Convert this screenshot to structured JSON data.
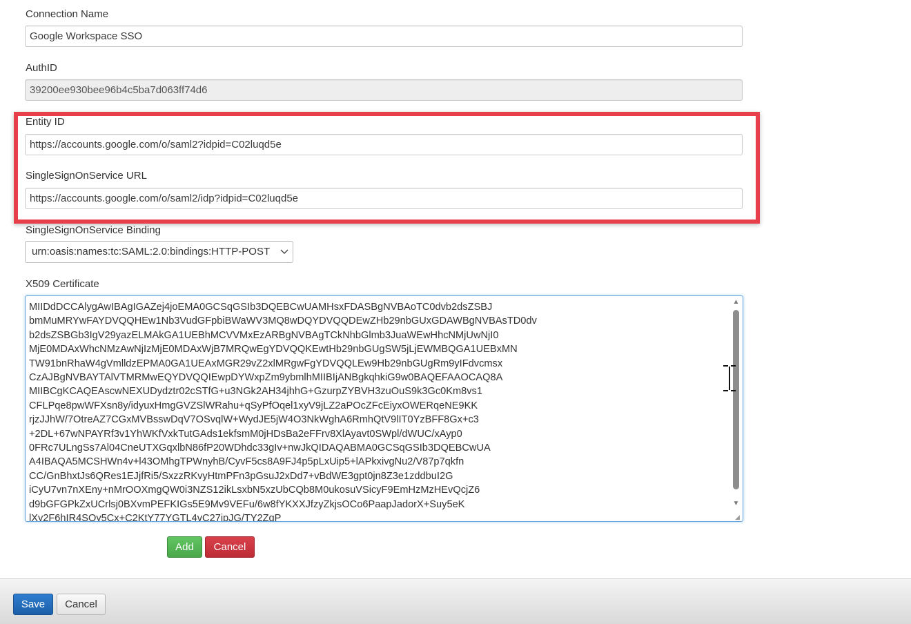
{
  "connection_name": {
    "label": "Connection Name",
    "value": "Google Workspace SSO"
  },
  "auth_id": {
    "label": "AuthID",
    "value": "39200ee930bee96b4c5ba7d063ff74d6"
  },
  "entity_id": {
    "label": "Entity ID",
    "value": "https://accounts.google.com/o/saml2?idpid=C02luqd5e"
  },
  "sso_url": {
    "label": "SingleSignOnService URL",
    "value": "https://accounts.google.com/o/saml2/idp?idpid=C02luqd5e"
  },
  "sso_binding": {
    "label": "SingleSignOnService Binding",
    "value": "urn:oasis:names:tc:SAML:2.0:bindings:HTTP-POST"
  },
  "certificate": {
    "label": "X509 Certificate",
    "lines": [
      "MIIDdDCCAlygAwIBAgIGAZej4joEMA0GCSqGSIb3DQEBCwUAMHsxFDASBgNVBAoTC0dvb2dsZSBJ",
      "bmMuMRYwFAYDVQQHEw1Nb3VudGFpbiBWaWV3MQ8wDQYDVQQDEwZHb29nbGUxGDAWBgNVBAsTD0dv",
      "b2dsZSBGb3IgV29yazELMAkGA1UEBhMCVVMxEzARBgNVBAgTCkNhbGlmb3JuaWEwHhcNMjUwNjI0",
      "MjE0MDAxWhcNMzAwNjIzMjE0MDAxWjB7MRQwEgYDVQQKEwtHb29nbGUgSW5jLjEWMBQGA1UEBxMN",
      "TW91bnRhaW4gVmlldzEPMA0GA1UEAxMGR29vZ2xlMRgwFgYDVQQLEw9Hb29nbGUgRm9yIFdvcmsx",
      "CzAJBgNVBAYTAlVTMRMwEQYDVQQIEwpDYWxpZm9ybmlhMIIBIjANBgkqhkiG9w0BAQEFAAOCAQ8A",
      "MIIBCgKCAQEAscwNEXUDydztr02cSTfG+u3NGk2AH34jhhG+GzurpZYBVH3zuOuS9k3Gc0Km8vs1",
      "CFLPqe8pwWFXsn8y/idyuxHmgGVZSlWRahu+qSyPfOqel1xyV9jLZ2aPOcZFcEiyxOWERqeNE9KK",
      "rjzJJhW/7OtreAZ7CGxMVBsswDqV7OSvqlW+WydJE5jW4O3NkWghA6RmhQtV9lIT0YzBFF8Gx+c3",
      "+2DL+67wNPAYRf3v1YhWKfVxkTutGAds1ekfsmM0jHDsBa2eFFrv8XlAyavt0SWpl/dWUC/xAyp0",
      "0FRc7ULngSs7Al04CneUTXGqxlbN86fP20WDhdc33gIv+nwJkQIDAQABMA0GCSqGSIb3DQEBCwUA",
      "A4IBAQA5MCSHWn4v+l43OMhgTPWnyhB/CyvF5cs8A9FJ4p5pLxUip5+lAPkxivgNu2/V87p7qkfn",
      "CC/GnBhxtJs6QRes1EJjfRi5/SxzzRKvyHtmPFn3pGsuJ2xDd7+vBdWE3gpt0jn8Z3e1zddbuI2G",
      "iCyU7vn7nXEny+nMrOOXmgQW0i3NZS12ikLsxbN5xzUbCQb8M0ukosuVSicyF9EmHzMzHEvQcjZ6",
      "d9bGFGPkZxUCrlsj0BXvmPEFKIGs5E9Mv9VEFu/6w8fYKXXJfzyZkjsOCo6PaapJadorX+Suy5eK",
      "lXy2F6hIR4SOy5Cx+C2KtY77YGTL4vC27ipJG/TY2ZqP"
    ]
  },
  "buttons": {
    "add": "Add",
    "cancel_form": "Cancel",
    "save": "Save",
    "cancel": "Cancel"
  },
  "colors": {
    "highlight": "#e8404a",
    "add": "#5cb85c",
    "cancel_red": "#c9302c",
    "save": "#1f64b0"
  }
}
